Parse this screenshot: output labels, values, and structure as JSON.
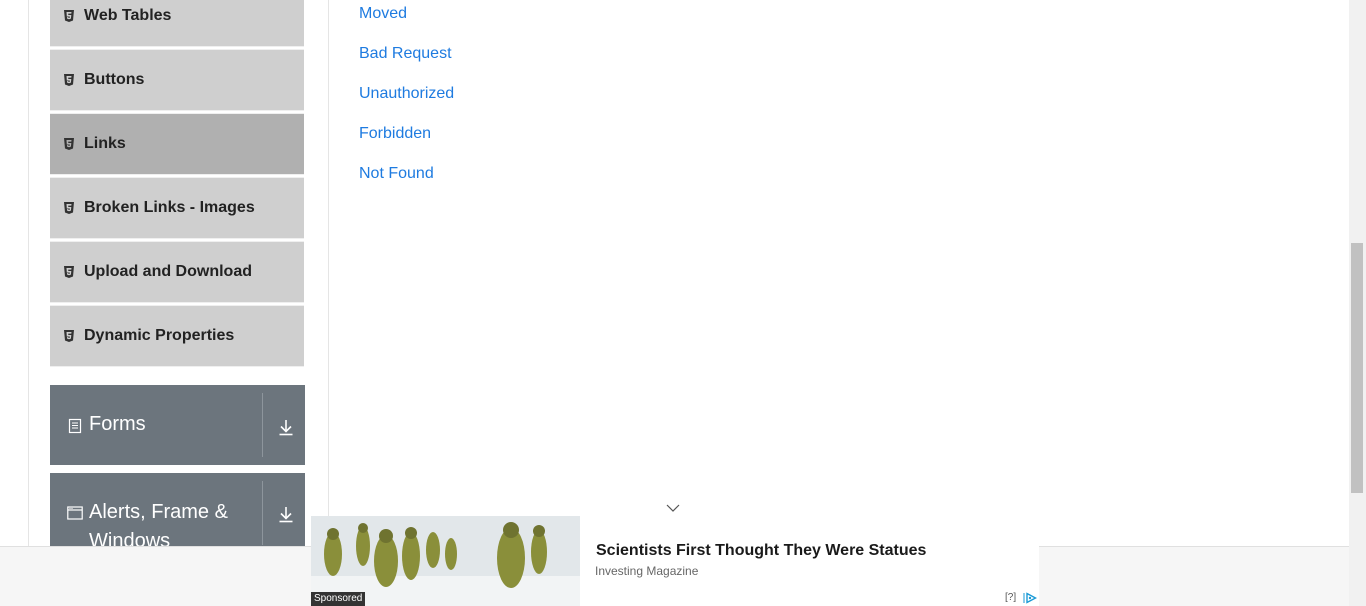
{
  "sidebar": {
    "elements_items": [
      {
        "label": "Web Tables"
      },
      {
        "label": "Buttons"
      },
      {
        "label": "Links"
      },
      {
        "label": "Broken Links - Images"
      },
      {
        "label": "Upload and Download"
      },
      {
        "label": "Dynamic Properties"
      }
    ],
    "active_item": "Links",
    "groups": [
      {
        "title": "Forms",
        "icon": "form-icon"
      },
      {
        "title": "Alerts, Frame & Windows",
        "icon": "window-icon"
      }
    ]
  },
  "main": {
    "links": [
      {
        "label": "Moved"
      },
      {
        "label": "Bad Request"
      },
      {
        "label": "Unauthorized"
      },
      {
        "label": "Forbidden"
      },
      {
        "label": "Not Found"
      }
    ]
  },
  "ad": {
    "headline": "Scientists First Thought They Were Statues",
    "source": "Investing Magazine",
    "sponsored_label": "Sponsored",
    "info_label": "[?]"
  },
  "colors": {
    "link": "#1e7be0",
    "menu_item_bg": "#cfcfcf",
    "menu_item_active_bg": "#b0b0b0",
    "group_bg": "#6c757d"
  }
}
